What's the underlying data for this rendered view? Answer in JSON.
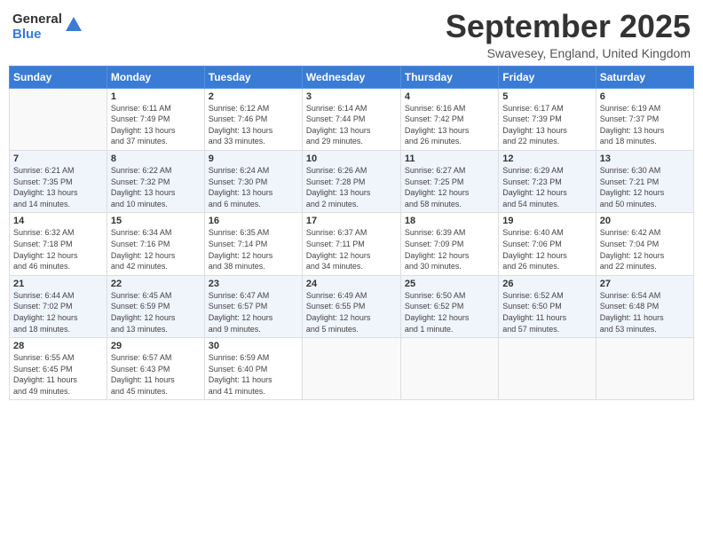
{
  "header": {
    "logo_general": "General",
    "logo_blue": "Blue",
    "month_title": "September 2025",
    "location": "Swavesey, England, United Kingdom"
  },
  "days_of_week": [
    "Sunday",
    "Monday",
    "Tuesday",
    "Wednesday",
    "Thursday",
    "Friday",
    "Saturday"
  ],
  "weeks": [
    [
      {
        "day": "",
        "info": ""
      },
      {
        "day": "1",
        "info": "Sunrise: 6:11 AM\nSunset: 7:49 PM\nDaylight: 13 hours\nand 37 minutes."
      },
      {
        "day": "2",
        "info": "Sunrise: 6:12 AM\nSunset: 7:46 PM\nDaylight: 13 hours\nand 33 minutes."
      },
      {
        "day": "3",
        "info": "Sunrise: 6:14 AM\nSunset: 7:44 PM\nDaylight: 13 hours\nand 29 minutes."
      },
      {
        "day": "4",
        "info": "Sunrise: 6:16 AM\nSunset: 7:42 PM\nDaylight: 13 hours\nand 26 minutes."
      },
      {
        "day": "5",
        "info": "Sunrise: 6:17 AM\nSunset: 7:39 PM\nDaylight: 13 hours\nand 22 minutes."
      },
      {
        "day": "6",
        "info": "Sunrise: 6:19 AM\nSunset: 7:37 PM\nDaylight: 13 hours\nand 18 minutes."
      }
    ],
    [
      {
        "day": "7",
        "info": "Sunrise: 6:21 AM\nSunset: 7:35 PM\nDaylight: 13 hours\nand 14 minutes."
      },
      {
        "day": "8",
        "info": "Sunrise: 6:22 AM\nSunset: 7:32 PM\nDaylight: 13 hours\nand 10 minutes."
      },
      {
        "day": "9",
        "info": "Sunrise: 6:24 AM\nSunset: 7:30 PM\nDaylight: 13 hours\nand 6 minutes."
      },
      {
        "day": "10",
        "info": "Sunrise: 6:26 AM\nSunset: 7:28 PM\nDaylight: 13 hours\nand 2 minutes."
      },
      {
        "day": "11",
        "info": "Sunrise: 6:27 AM\nSunset: 7:25 PM\nDaylight: 12 hours\nand 58 minutes."
      },
      {
        "day": "12",
        "info": "Sunrise: 6:29 AM\nSunset: 7:23 PM\nDaylight: 12 hours\nand 54 minutes."
      },
      {
        "day": "13",
        "info": "Sunrise: 6:30 AM\nSunset: 7:21 PM\nDaylight: 12 hours\nand 50 minutes."
      }
    ],
    [
      {
        "day": "14",
        "info": "Sunrise: 6:32 AM\nSunset: 7:18 PM\nDaylight: 12 hours\nand 46 minutes."
      },
      {
        "day": "15",
        "info": "Sunrise: 6:34 AM\nSunset: 7:16 PM\nDaylight: 12 hours\nand 42 minutes."
      },
      {
        "day": "16",
        "info": "Sunrise: 6:35 AM\nSunset: 7:14 PM\nDaylight: 12 hours\nand 38 minutes."
      },
      {
        "day": "17",
        "info": "Sunrise: 6:37 AM\nSunset: 7:11 PM\nDaylight: 12 hours\nand 34 minutes."
      },
      {
        "day": "18",
        "info": "Sunrise: 6:39 AM\nSunset: 7:09 PM\nDaylight: 12 hours\nand 30 minutes."
      },
      {
        "day": "19",
        "info": "Sunrise: 6:40 AM\nSunset: 7:06 PM\nDaylight: 12 hours\nand 26 minutes."
      },
      {
        "day": "20",
        "info": "Sunrise: 6:42 AM\nSunset: 7:04 PM\nDaylight: 12 hours\nand 22 minutes."
      }
    ],
    [
      {
        "day": "21",
        "info": "Sunrise: 6:44 AM\nSunset: 7:02 PM\nDaylight: 12 hours\nand 18 minutes."
      },
      {
        "day": "22",
        "info": "Sunrise: 6:45 AM\nSunset: 6:59 PM\nDaylight: 12 hours\nand 13 minutes."
      },
      {
        "day": "23",
        "info": "Sunrise: 6:47 AM\nSunset: 6:57 PM\nDaylight: 12 hours\nand 9 minutes."
      },
      {
        "day": "24",
        "info": "Sunrise: 6:49 AM\nSunset: 6:55 PM\nDaylight: 12 hours\nand 5 minutes."
      },
      {
        "day": "25",
        "info": "Sunrise: 6:50 AM\nSunset: 6:52 PM\nDaylight: 12 hours\nand 1 minute."
      },
      {
        "day": "26",
        "info": "Sunrise: 6:52 AM\nSunset: 6:50 PM\nDaylight: 11 hours\nand 57 minutes."
      },
      {
        "day": "27",
        "info": "Sunrise: 6:54 AM\nSunset: 6:48 PM\nDaylight: 11 hours\nand 53 minutes."
      }
    ],
    [
      {
        "day": "28",
        "info": "Sunrise: 6:55 AM\nSunset: 6:45 PM\nDaylight: 11 hours\nand 49 minutes."
      },
      {
        "day": "29",
        "info": "Sunrise: 6:57 AM\nSunset: 6:43 PM\nDaylight: 11 hours\nand 45 minutes."
      },
      {
        "day": "30",
        "info": "Sunrise: 6:59 AM\nSunset: 6:40 PM\nDaylight: 11 hours\nand 41 minutes."
      },
      {
        "day": "",
        "info": ""
      },
      {
        "day": "",
        "info": ""
      },
      {
        "day": "",
        "info": ""
      },
      {
        "day": "",
        "info": ""
      }
    ]
  ]
}
